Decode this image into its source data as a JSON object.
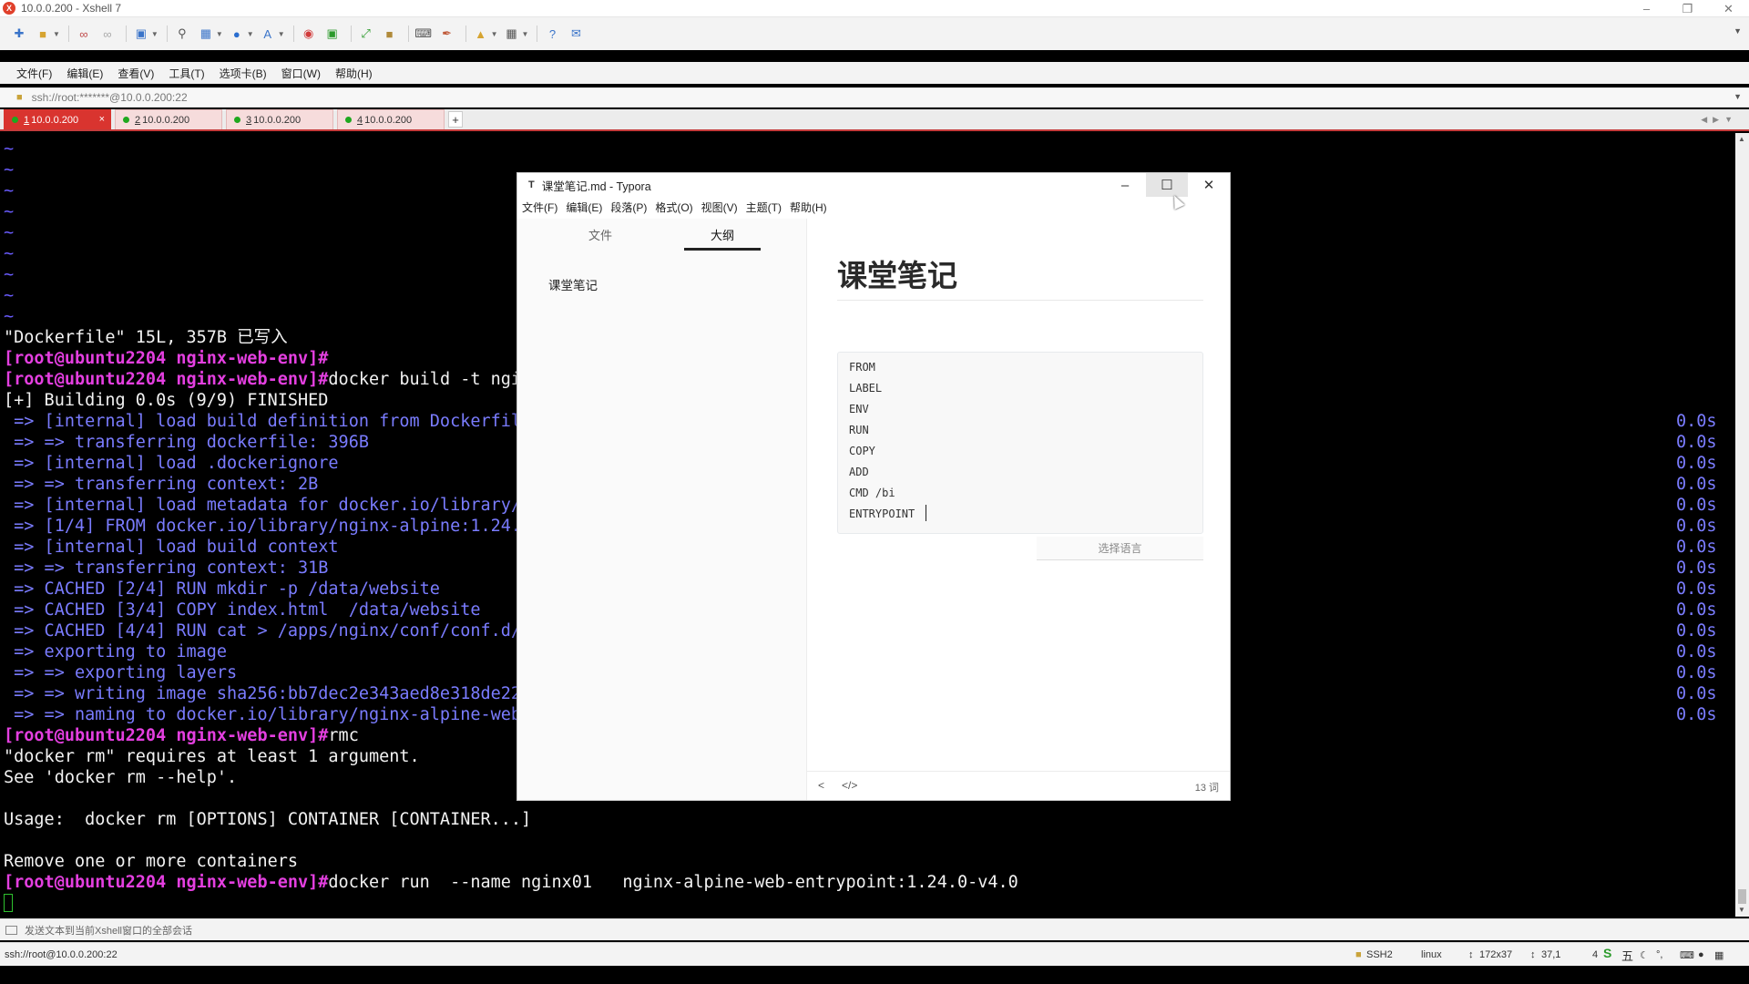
{
  "xshell": {
    "window_title": "10.0.0.200 - Xshell 7",
    "menu": [
      "文件(F)",
      "编辑(E)",
      "查看(V)",
      "工具(T)",
      "选项卡(B)",
      "窗口(W)",
      "帮助(H)"
    ],
    "address": "ssh://root:*******@10.0.0.200:22",
    "tabs": [
      {
        "num": "1",
        "label": " 10.0.0.200",
        "active": true
      },
      {
        "num": "2",
        "label": " 10.0.0.200",
        "active": false
      },
      {
        "num": "3",
        "label": " 10.0.0.200",
        "active": false
      },
      {
        "num": "4",
        "label": " 10.0.0.200",
        "active": false
      }
    ],
    "send_bar": "发送文本到当前Xshell窗口的全部会话",
    "status": {
      "connection": "ssh://root@10.0.0.200:22",
      "protocol": "SSH2",
      "term": "linux",
      "size": "172x37",
      "cursor": "37,1",
      "sessions": "4"
    }
  },
  "terminal": {
    "tilde": "~",
    "write_msg": "\"Dockerfile\" 15L, 357B 已写入",
    "prompt": "[root@ubuntu2204 nginx-web-env]#",
    "build_cmd": "docker build -t ngi",
    "build_status": "[+] Building 0.0s (9/9) FINISHED",
    "build_steps": [
      " => [internal] load build definition from Dockerfil",
      " => => transferring dockerfile: 396B",
      " => [internal] load .dockerignore",
      " => => transferring context: 2B",
      " => [internal] load metadata for docker.io/library/",
      " => [1/4] FROM docker.io/library/nginx-alpine:1.24.",
      " => [internal] load build context",
      " => => transferring context: 31B",
      " => CACHED [2/4] RUN mkdir -p /data/website",
      " => CACHED [3/4] COPY index.html  /data/website",
      " => CACHED [4/4] RUN cat > /apps/nginx/conf/conf.d/",
      " => exporting to image",
      " => => exporting layers",
      " => => writing image sha256:bb7dec2e343aed8e318de22",
      " => => naming to docker.io/library/nginx-alpine-web"
    ],
    "step_time": "0.0s",
    "rm_cmd": "rmc",
    "err1": "\"docker rm\" requires at least 1 argument.",
    "err2": "See 'docker rm --help'.",
    "usage": "Usage:  docker rm [OPTIONS] CONTAINER [CONTAINER...]",
    "desc": "Remove one or more containers",
    "run_cmd": "docker run  --name nginx01   nginx-alpine-web-entrypoint:1.24.0-v4.0"
  },
  "typora": {
    "title": "课堂笔记.md - Typora",
    "logo": "T",
    "menu": [
      "文件(F)",
      "编辑(E)",
      "段落(P)",
      "格式(O)",
      "视图(V)",
      "主题(T)",
      "帮助(H)"
    ],
    "side_tab_files": "文件",
    "side_tab_outline": "大纲",
    "outline_item": "课堂笔记",
    "heading": "课堂笔记",
    "code_lines": [
      "FROM",
      "LABEL",
      "ENV",
      "RUN",
      "COPY",
      "ADD",
      "CMD /bi",
      "ENTRYPOINT"
    ],
    "lang_placeholder": "选择语言",
    "word_count": "13 词"
  }
}
